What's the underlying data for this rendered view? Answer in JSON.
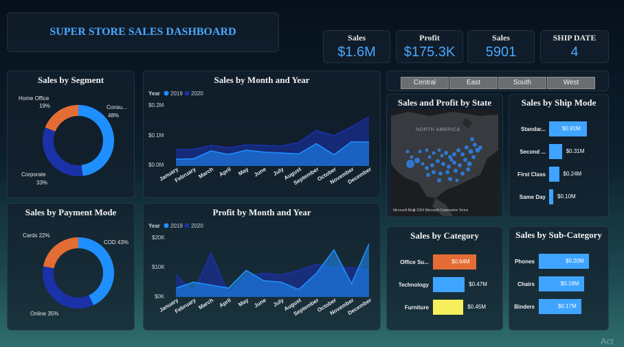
{
  "header": {
    "title": "SUPER STORE SALES DASHBOARD"
  },
  "kpis": [
    {
      "label": "Sales",
      "value": "$1.6M"
    },
    {
      "label": "Profit",
      "value": "$175.3K"
    },
    {
      "label": "Sales",
      "value": "5901"
    },
    {
      "label": "SHIP DATE",
      "value": "4"
    }
  ],
  "colors": {
    "accent": "#4aa8ff",
    "blue_dark": "#1a31a8",
    "blue_light": "#1f8fff",
    "orange": "#e46d35",
    "yellow": "#f6ee5d"
  },
  "segment": {
    "title": "Sales by Segment",
    "labels": {
      "home": "Home Office",
      "home_pct": "19%",
      "cons": "Consu...",
      "cons_pct": "48%",
      "corp": "Corporate",
      "corp_pct": "33%"
    }
  },
  "payment": {
    "title": "Sales by Payment Mode",
    "labels": {
      "cards": "Cards 22%",
      "cod": "COD 43%",
      "online": "Online 35%"
    }
  },
  "months": [
    "January",
    "February",
    "March",
    "April",
    "May",
    "June",
    "July",
    "August",
    "September",
    "October",
    "November",
    "December"
  ],
  "sales_month": {
    "title": "Sales by Month and Year",
    "legend_title": "Year",
    "legend": [
      "2019",
      "2020"
    ],
    "yticks": [
      "$0.2M",
      "$0.1M",
      "$0.0M"
    ]
  },
  "profit_month": {
    "title": "Profit by Month and Year",
    "legend_title": "Year",
    "legend": [
      "2019",
      "2020"
    ],
    "yticks": [
      "$20K",
      "$10K",
      "$0K"
    ]
  },
  "regions": [
    "Central",
    "East",
    "South",
    "West"
  ],
  "map": {
    "title": "Sales and Profit by State",
    "label": "NORTH AMERICA",
    "credit": "Microsoft Bing",
    "copyright": "© 2024 Microsoft Corporation  Terms"
  },
  "ship_mode": {
    "title": "Sales by Ship Mode",
    "items": [
      {
        "label": "Standar...",
        "value": "$0.91M"
      },
      {
        "label": "Second ...",
        "value": "$0.31M"
      },
      {
        "label": "First Class",
        "value": "$0.24M"
      },
      {
        "label": "Same Day",
        "value": "$0.10M"
      }
    ]
  },
  "category": {
    "title": "Sales by Category",
    "items": [
      {
        "label": "Office Su...",
        "value": "$0.64M"
      },
      {
        "label": "Technology",
        "value": "$0.47M"
      },
      {
        "label": "Furniture",
        "value": "$0.45M"
      }
    ]
  },
  "subcategory": {
    "title": "Sales by Sub-Category",
    "items": [
      {
        "label": "Phones",
        "value": "$0.20M"
      },
      {
        "label": "Chairs",
        "value": "$0.18M"
      },
      {
        "label": "Binders",
        "value": "$0.17M"
      }
    ]
  },
  "watermark": "Act",
  "chart_data": [
    {
      "type": "pie",
      "title": "Sales by Segment",
      "categories": [
        "Consumer",
        "Corporate",
        "Home Office"
      ],
      "values": [
        48,
        33,
        19
      ]
    },
    {
      "type": "pie",
      "title": "Sales by Payment Mode",
      "categories": [
        "COD",
        "Online",
        "Cards"
      ],
      "values": [
        43,
        35,
        22
      ]
    },
    {
      "type": "area",
      "title": "Sales by Month and Year",
      "categories": [
        "January",
        "February",
        "March",
        "April",
        "May",
        "June",
        "July",
        "August",
        "September",
        "October",
        "November",
        "December"
      ],
      "ylim": [
        0,
        0.2
      ],
      "series": [
        {
          "name": "2019",
          "values": [
            0.022,
            0.024,
            0.05,
            0.038,
            0.052,
            0.046,
            0.043,
            0.04,
            0.074,
            0.037,
            0.08,
            0.079
          ]
        },
        {
          "name": "2020",
          "values": [
            0.055,
            0.055,
            0.068,
            0.06,
            0.07,
            0.068,
            0.066,
            0.078,
            0.118,
            0.1,
            0.13,
            0.163
          ]
        }
      ]
    },
    {
      "type": "area",
      "title": "Profit by Month and Year",
      "categories": [
        "January",
        "February",
        "March",
        "April",
        "May",
        "June",
        "July",
        "August",
        "September",
        "October",
        "November",
        "December"
      ],
      "ylim": [
        0,
        20000
      ],
      "series": [
        {
          "name": "2019",
          "values": [
            3000,
            5000,
            4000,
            3000,
            9000,
            5500,
            5000,
            2500,
            8000,
            16000,
            4500,
            18000
          ]
        },
        {
          "name": "2020",
          "values": [
            7500,
            1500,
            15000,
            1000,
            7000,
            8000,
            7500,
            9000,
            11000,
            10000,
            10000,
            9000
          ]
        }
      ]
    },
    {
      "type": "bar",
      "title": "Sales by Ship Mode",
      "categories": [
        "Standard Class",
        "Second Class",
        "First Class",
        "Same Day"
      ],
      "values": [
        0.91,
        0.31,
        0.24,
        0.1
      ]
    },
    {
      "type": "bar",
      "title": "Sales by Category",
      "categories": [
        "Office Supplies",
        "Technology",
        "Furniture"
      ],
      "values": [
        0.64,
        0.47,
        0.45
      ]
    },
    {
      "type": "bar",
      "title": "Sales by Sub-Category",
      "categories": [
        "Phones",
        "Chairs",
        "Binders"
      ],
      "values": [
        0.2,
        0.18,
        0.17
      ]
    }
  ]
}
